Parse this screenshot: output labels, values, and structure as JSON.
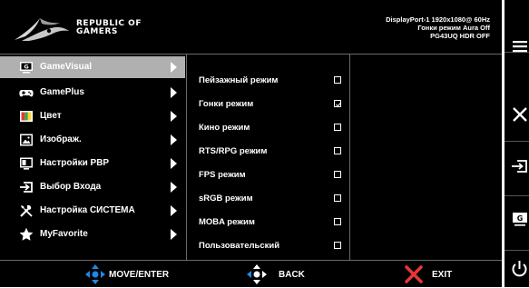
{
  "brand": {
    "line1": "REPUBLIC OF",
    "line2": "GAMERS"
  },
  "status": {
    "line1": "DisplayPort-1 1920x1080@ 60Hz",
    "line2": "Гонки режим Aura Off",
    "line3": "PG43UQ HDR OFF"
  },
  "menu": {
    "items": [
      {
        "label": "GameVisual",
        "icon": "gamevisual-icon",
        "selected": true
      },
      {
        "label": "GamePlus",
        "icon": "gamepad-icon"
      },
      {
        "label": "Цвет",
        "icon": "color-icon"
      },
      {
        "label": "Изображ.",
        "icon": "image-icon"
      },
      {
        "label": "Настройки PBP",
        "icon": "pbp-icon"
      },
      {
        "label": "Выбор Входа",
        "icon": "input-icon"
      },
      {
        "label": "Настройка СИСТЕМА",
        "icon": "system-tools-icon"
      },
      {
        "label": "MyFavorite",
        "icon": "star-icon"
      }
    ]
  },
  "submenu": {
    "items": [
      {
        "label": "Пейзажный режим",
        "checked": false
      },
      {
        "label": "Гонки режим",
        "checked": true
      },
      {
        "label": "Кино режим",
        "checked": false
      },
      {
        "label": "RTS/RPG режим",
        "checked": false
      },
      {
        "label": "FPS режим",
        "checked": false
      },
      {
        "label": "sRGB режим",
        "checked": false
      },
      {
        "label": "MOBA режим",
        "checked": false
      },
      {
        "label": "Пользовательский",
        "checked": false
      }
    ]
  },
  "footer": {
    "move_enter": "MOVE/ENTER",
    "back": "BACK",
    "exit": "EXIT"
  },
  "sidebar": {
    "icons": [
      "menu-icon",
      "close-icon",
      "input-select-icon",
      "gamevisual-key-icon",
      "power-icon"
    ]
  },
  "colors": {
    "accent_blue": "#1e88e5",
    "exit_red": "#e53935",
    "selected_bg": "#b0b0b0"
  }
}
